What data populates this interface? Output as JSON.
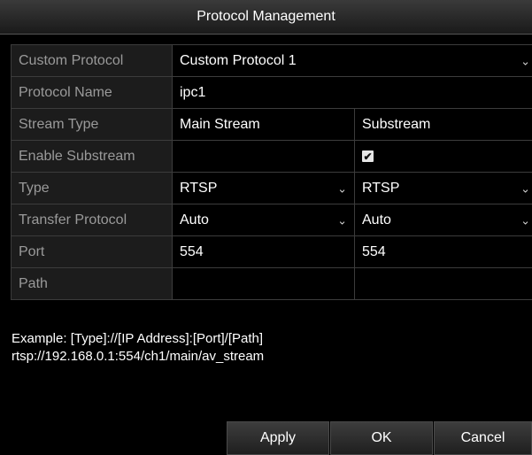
{
  "title": "Protocol Management",
  "rows": {
    "custom_protocol": {
      "label": "Custom Protocol",
      "value": "Custom Protocol 1"
    },
    "protocol_name": {
      "label": "Protocol Name",
      "value": "ipc1"
    },
    "stream_type": {
      "label": "Stream Type",
      "main": "Main Stream",
      "sub": "Substream"
    },
    "enable_substream": {
      "label": "Enable Substream",
      "sub_checked": true,
      "check_glyph": "✔"
    },
    "type": {
      "label": "Type",
      "main": "RTSP",
      "sub": "RTSP"
    },
    "transfer_protocol": {
      "label": "Transfer Protocol",
      "main": "Auto",
      "sub": "Auto"
    },
    "port": {
      "label": "Port",
      "main": "554",
      "sub": "554"
    },
    "path": {
      "label": "Path",
      "main": "",
      "sub": ""
    }
  },
  "example": {
    "line1": "Example: [Type]://[IP Address]:[Port]/[Path]",
    "line2": "rtsp://192.168.0.1:554/ch1/main/av_stream"
  },
  "buttons": {
    "apply": "Apply",
    "ok": "OK",
    "cancel": "Cancel"
  },
  "icons": {
    "dropdown": "chevron-down-icon",
    "dropdown_glyph": "⌄"
  },
  "colors": {
    "label_bg": "#1c1c1c",
    "label_text": "#9a9a9a",
    "value_text": "#ffffff",
    "border": "#3c3c3c"
  }
}
